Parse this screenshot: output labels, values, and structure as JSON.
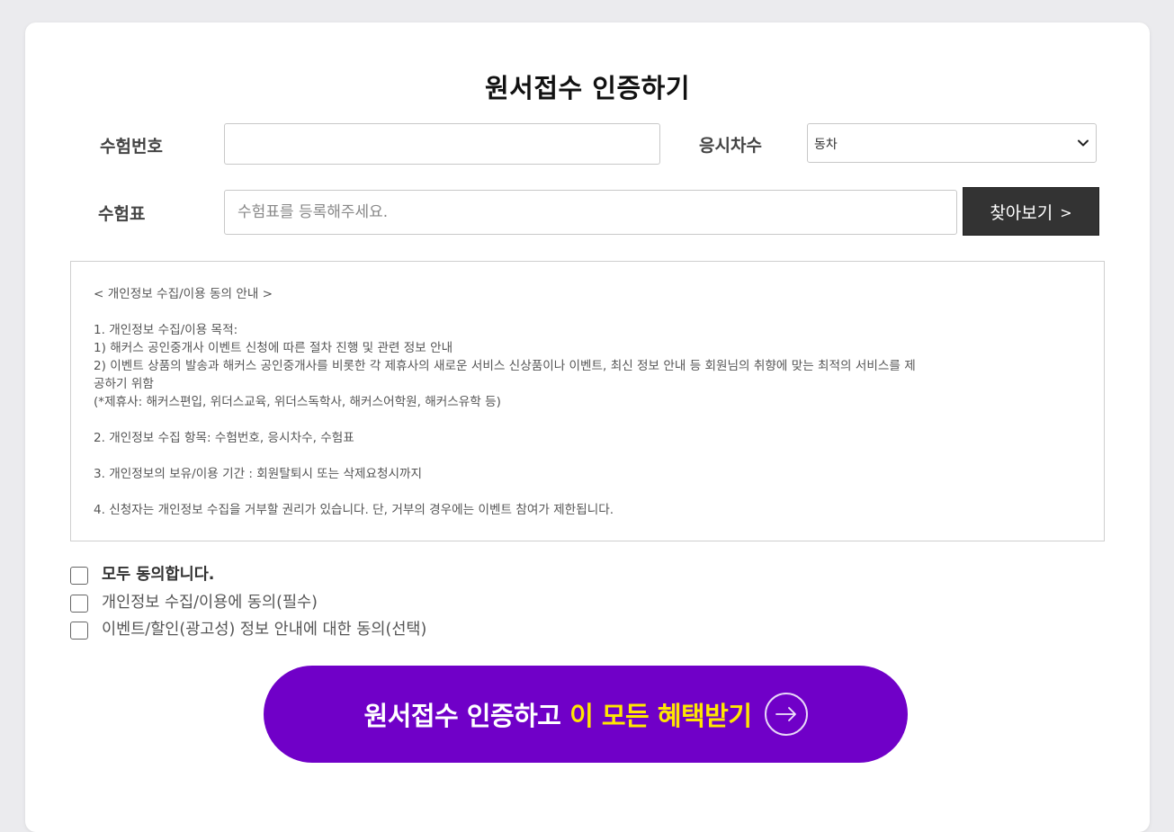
{
  "page": {
    "title": "원서접수 인증하기"
  },
  "form": {
    "exam_number_label": "수험번호",
    "exam_number_value": "",
    "session_label": "응시차수",
    "session_selected": "동차",
    "ticket_label": "수험표",
    "ticket_placeholder": "수험표를 등록해주세요.",
    "find_button_label": "찾아보기",
    "find_button_arrow": ">"
  },
  "notice": {
    "heading": "< 개인정보 수집/이용 동의 안내 >",
    "lines_group1": [
      "1. 개인정보 수집/이용 목적:",
      "1) 해커스 공인중개사 이벤트 신청에 따른 절차 진행 및 관련 정보 안내",
      "2) 이벤트 상품의 발송과 해커스 공인중개사를 비롯한 각 제휴사의 새로운 서비스 신상품이나 이벤트, 최신 정보 안내 등 회원님의 취향에 맞는 최적의 서비스를 제",
      "공하기 위함",
      "(*제휴사: 해커스편입, 위더스교육, 위더스독학사, 해커스어학원, 해커스유학 등)"
    ],
    "line_items": "2. 개인정보 수집 항목: 수험번호, 응시차수, 수험표",
    "line_period": "3. 개인정보의 보유/이용 기간 : 회원탈퇴시 또는 삭제요청시까지",
    "line_rights": "4. 신청자는 개인정보 수집을 거부할 권리가 있습니다. 단, 거부의 경우에는 이벤트 참여가 제한됩니다."
  },
  "agreements": {
    "all": "모두 동의합니다.",
    "required": "개인정보 수집/이용에 동의(필수)",
    "optional": "이벤트/할인(광고성) 정보 안내에 대한 동의(선택)"
  },
  "cta": {
    "text_main": "원서접수 인증하고 ",
    "text_highlight": "이 모든 혜택받기",
    "icon": "arrow-right-circle-icon"
  },
  "colors": {
    "background": "#ebebee",
    "cta_purple": "#7000c8",
    "cta_highlight": "#ffe600",
    "find_button": "#333333"
  }
}
